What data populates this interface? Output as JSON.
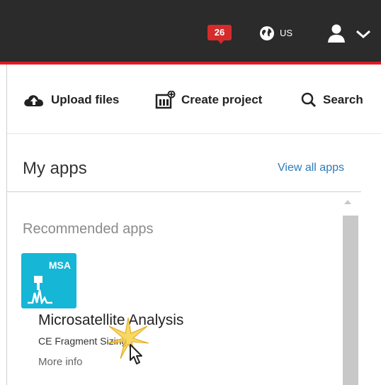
{
  "header": {
    "notification_count": "26",
    "region": "US",
    "icons": [
      "globe-icon",
      "user-icon",
      "chevron-down-icon"
    ]
  },
  "toolbar": {
    "upload_label": "Upload files",
    "create_label": "Create project",
    "search_label": "Search"
  },
  "my_apps": {
    "title": "My apps",
    "view_all": "View all apps",
    "section_title": "Recommended apps",
    "app": {
      "abbr": "MSA",
      "name": "Microsatellite Analysis",
      "subtitle": "CE Fragment Sizing",
      "more_info": "More info"
    }
  },
  "colors": {
    "header_bg": "#2b2b2b",
    "accent_red": "#e11b22",
    "tile_blue": "#15b6d6",
    "link_blue": "#2b7bb9"
  }
}
